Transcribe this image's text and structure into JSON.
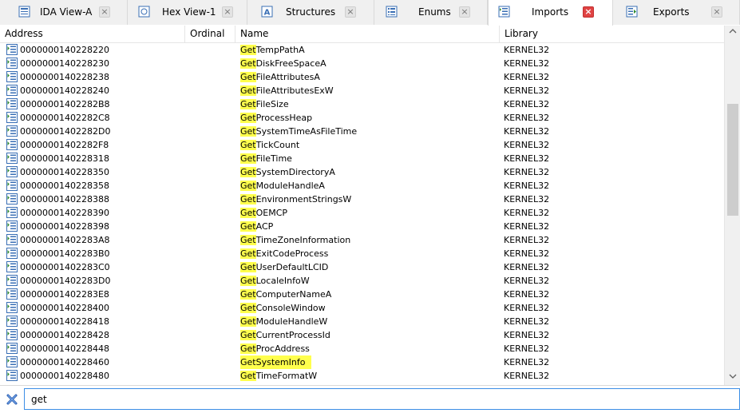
{
  "tabs": [
    {
      "label": "IDA View-A",
      "icon": "ida-view-icon",
      "active": false
    },
    {
      "label": "Hex View-1",
      "icon": "hex-view-icon",
      "active": false
    },
    {
      "label": "Structures",
      "icon": "structures-icon",
      "active": false
    },
    {
      "label": "Enums",
      "icon": "enums-icon",
      "active": false
    },
    {
      "label": "Imports",
      "icon": "imports-icon",
      "active": true
    },
    {
      "label": "Exports",
      "icon": "exports-icon",
      "active": false
    }
  ],
  "columns": {
    "address": "Address",
    "ordinal": "Ordinal",
    "name": "Name",
    "library": "Library"
  },
  "highlight_prefix": "Get",
  "highlight_color": "#ffff4d",
  "rows": [
    {
      "address": "0000000140228220",
      "ordinal": "",
      "name_prefix": "Get",
      "name_rest": "TempPathA",
      "library": "KERNEL32"
    },
    {
      "address": "0000000140228230",
      "ordinal": "",
      "name_prefix": "Get",
      "name_rest": "DiskFreeSpaceA",
      "library": "KERNEL32"
    },
    {
      "address": "0000000140228238",
      "ordinal": "",
      "name_prefix": "Get",
      "name_rest": "FileAttributesA",
      "library": "KERNEL32"
    },
    {
      "address": "0000000140228240",
      "ordinal": "",
      "name_prefix": "Get",
      "name_rest": "FileAttributesExW",
      "library": "KERNEL32"
    },
    {
      "address": "00000001402282B8",
      "ordinal": "",
      "name_prefix": "Get",
      "name_rest": "FileSize",
      "library": "KERNEL32"
    },
    {
      "address": "00000001402282C8",
      "ordinal": "",
      "name_prefix": "Get",
      "name_rest": "ProcessHeap",
      "library": "KERNEL32"
    },
    {
      "address": "00000001402282D0",
      "ordinal": "",
      "name_prefix": "Get",
      "name_rest": "SystemTimeAsFileTime",
      "library": "KERNEL32"
    },
    {
      "address": "00000001402282F8",
      "ordinal": "",
      "name_prefix": "Get",
      "name_rest": "TickCount",
      "library": "KERNEL32"
    },
    {
      "address": "0000000140228318",
      "ordinal": "",
      "name_prefix": "Get",
      "name_rest": "FileTime",
      "library": "KERNEL32"
    },
    {
      "address": "0000000140228350",
      "ordinal": "",
      "name_prefix": "Get",
      "name_rest": "SystemDirectoryA",
      "library": "KERNEL32"
    },
    {
      "address": "0000000140228358",
      "ordinal": "",
      "name_prefix": "Get",
      "name_rest": "ModuleHandleA",
      "library": "KERNEL32"
    },
    {
      "address": "0000000140228388",
      "ordinal": "",
      "name_prefix": "Get",
      "name_rest": "EnvironmentStringsW",
      "library": "KERNEL32"
    },
    {
      "address": "0000000140228390",
      "ordinal": "",
      "name_prefix": "Get",
      "name_rest": "OEMCP",
      "library": "KERNEL32"
    },
    {
      "address": "0000000140228398",
      "ordinal": "",
      "name_prefix": "Get",
      "name_rest": "ACP",
      "library": "KERNEL32"
    },
    {
      "address": "00000001402283A8",
      "ordinal": "",
      "name_prefix": "Get",
      "name_rest": "TimeZoneInformation",
      "library": "KERNEL32"
    },
    {
      "address": "00000001402283B0",
      "ordinal": "",
      "name_prefix": "Get",
      "name_rest": "ExitCodeProcess",
      "library": "KERNEL32"
    },
    {
      "address": "00000001402283C0",
      "ordinal": "",
      "name_prefix": "Get",
      "name_rest": "UserDefaultLCID",
      "library": "KERNEL32"
    },
    {
      "address": "00000001402283D0",
      "ordinal": "",
      "name_prefix": "Get",
      "name_rest": "LocaleInfoW",
      "library": "KERNEL32"
    },
    {
      "address": "00000001402283E8",
      "ordinal": "",
      "name_prefix": "Get",
      "name_rest": "ComputerNameA",
      "library": "KERNEL32"
    },
    {
      "address": "0000000140228400",
      "ordinal": "",
      "name_prefix": "Get",
      "name_rest": "ConsoleWindow",
      "library": "KERNEL32"
    },
    {
      "address": "0000000140228418",
      "ordinal": "",
      "name_prefix": "Get",
      "name_rest": "ModuleHandleW",
      "library": "KERNEL32"
    },
    {
      "address": "0000000140228428",
      "ordinal": "",
      "name_prefix": "Get",
      "name_rest": "CurrentProcessId",
      "library": "KERNEL32"
    },
    {
      "address": "0000000140228448",
      "ordinal": "",
      "name_prefix": "Get",
      "name_rest": "ProcAddress",
      "library": "KERNEL32"
    },
    {
      "address": "0000000140228460",
      "ordinal": "",
      "name_prefix": "Get",
      "name_rest": "SystemInfo",
      "library": "KERNEL32",
      "selected": true
    },
    {
      "address": "0000000140228480",
      "ordinal": "",
      "name_prefix": "Get",
      "name_rest": "TimeFormatW",
      "library": "KERNEL32"
    }
  ],
  "filter": {
    "value": "get",
    "close_icon": "close-filter-icon"
  },
  "scrollbar": {
    "up_icon": "scroll-up-icon",
    "down_icon": "scroll-down-icon"
  }
}
